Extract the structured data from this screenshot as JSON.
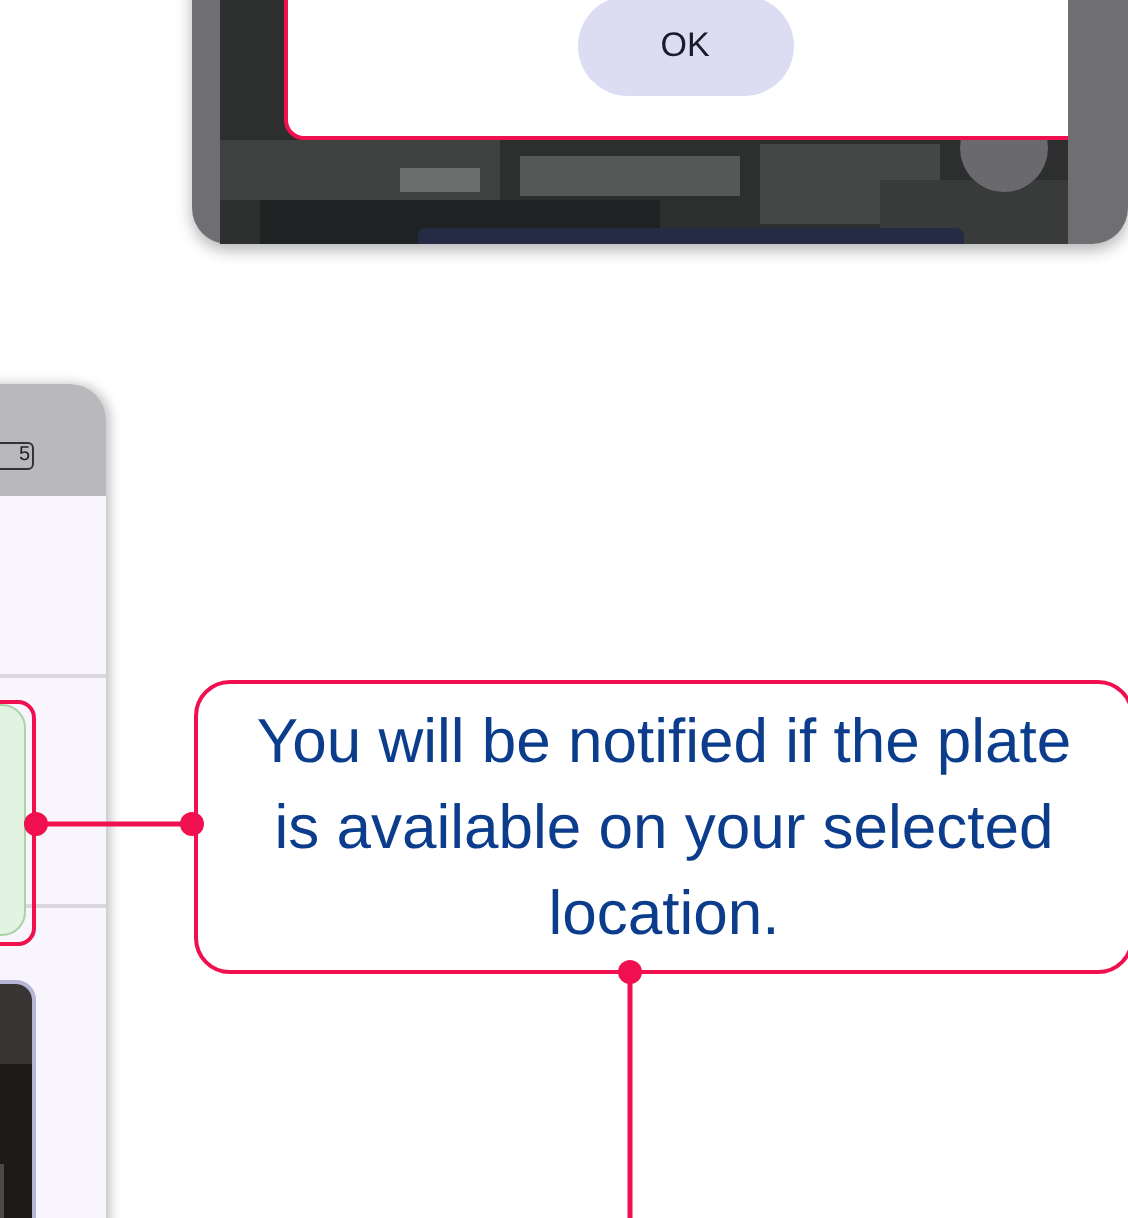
{
  "top_phone": {
    "dialog": {
      "button": "OK"
    }
  },
  "left_phone": {
    "status_bar": {
      "battery": "5"
    }
  },
  "callout": {
    "text": "You will be notified if the plate is available on your selected location."
  }
}
